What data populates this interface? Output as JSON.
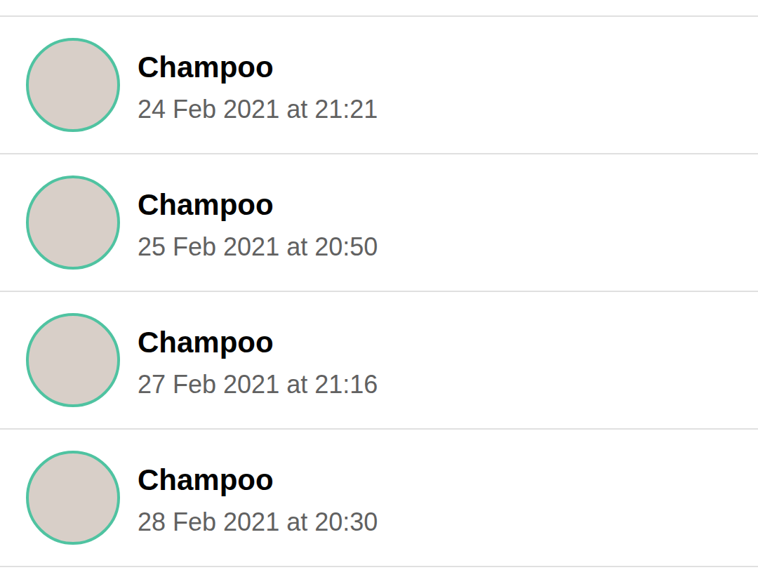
{
  "entries": [
    {
      "name": "Champoo",
      "time": "24 Feb 2021 at 21:21"
    },
    {
      "name": "Champoo",
      "time": "25 Feb 2021 at 20:50"
    },
    {
      "name": "Champoo",
      "time": "27 Feb 2021 at 21:16"
    },
    {
      "name": "Champoo",
      "time": "28 Feb 2021 at 20:30"
    }
  ]
}
